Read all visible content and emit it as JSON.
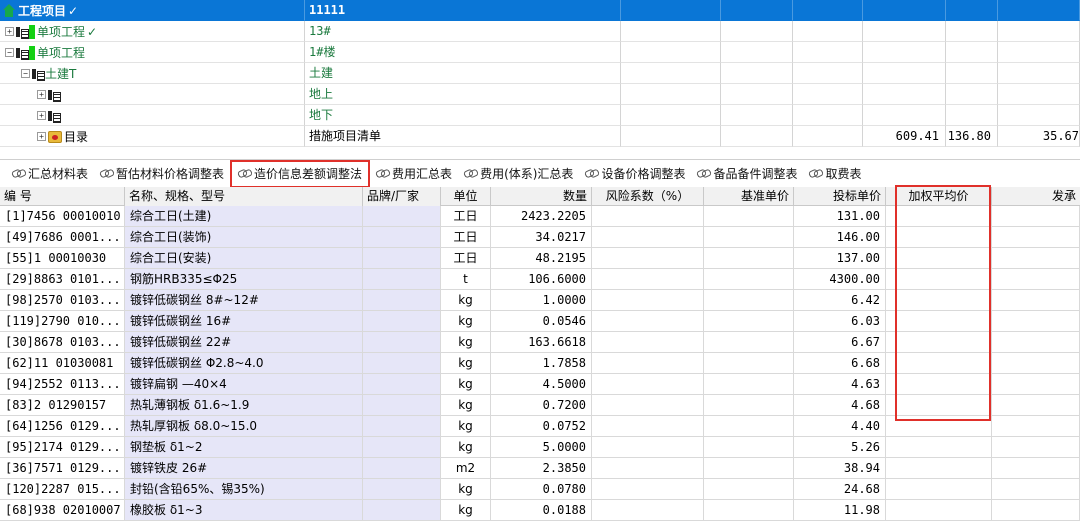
{
  "tree": {
    "rows": [
      {
        "name": "工程项目",
        "code": "11111",
        "selected": true,
        "icon": "home-icon"
      },
      {
        "name": "单项工程",
        "code": "13#",
        "icon": "grid-icon"
      },
      {
        "name": "单项工程",
        "code": "1#楼",
        "icon": "grid-icon"
      },
      {
        "name": "土建T",
        "code": "土建",
        "icon": "grid-icon"
      },
      {
        "name": "",
        "code": "地上",
        "icon": "grid-icon"
      },
      {
        "name": "",
        "code": "地下",
        "icon": "grid-icon"
      },
      {
        "name": "目录",
        "code": "措施项目清单",
        "icon": "folder-icon",
        "v1": "609.41",
        "v2": "136.80",
        "v3": "35.67"
      }
    ]
  },
  "tabs": [
    {
      "label": "汇总材料表"
    },
    {
      "label": "暂估材料价格调整表"
    },
    {
      "label": "造价信息差额调整法",
      "active": true
    },
    {
      "label": "费用汇总表"
    },
    {
      "label": "费用(体系)汇总表"
    },
    {
      "label": "设备价格调整表"
    },
    {
      "label": "备品备件调整表"
    },
    {
      "label": "取费表"
    }
  ],
  "grid": {
    "headers": [
      "编 号",
      "名称、规格、型号",
      "品牌/厂家",
      "单位",
      "数量",
      "风险系数（%）",
      "基准单价",
      "投标单价",
      "加权平均价",
      "发承"
    ],
    "rows": [
      {
        "code": "[1]7456 00010010",
        "name": "综合工日(土建)",
        "unit": "工日",
        "qty": "2423.2205",
        "price": "131.00"
      },
      {
        "code": "[49]7686 0001...",
        "name": "综合工日(装饰)",
        "unit": "工日",
        "qty": "34.0217",
        "price": "146.00"
      },
      {
        "code": "[55]1 00010030",
        "name": "综合工日(安装)",
        "unit": "工日",
        "qty": "48.2195",
        "price": "137.00"
      },
      {
        "code": "[29]8863 0101...",
        "name": "钢筋HRB335≤Φ25",
        "unit": "t",
        "qty": "106.6000",
        "price": "4300.00"
      },
      {
        "code": "[98]2570 0103...",
        "name": "镀锌低碳钢丝 8#~12#",
        "unit": "kg",
        "qty": "1.0000",
        "price": "6.42"
      },
      {
        "code": "[119]2790 010...",
        "name": "镀锌低碳钢丝 16#",
        "unit": "kg",
        "qty": "0.0546",
        "price": "6.03"
      },
      {
        "code": "[30]8678 0103...",
        "name": "镀锌低碳钢丝 22#",
        "unit": "kg",
        "qty": "163.6618",
        "price": "6.67"
      },
      {
        "code": "[62]11 01030081",
        "name": "镀锌低碳钢丝 Φ2.8~4.0",
        "unit": "kg",
        "qty": "1.7858",
        "price": "6.68"
      },
      {
        "code": "[94]2552 0113...",
        "name": "镀锌扁钢 —40×4",
        "unit": "kg",
        "qty": "4.5000",
        "price": "4.63"
      },
      {
        "code": "[83]2 01290157",
        "name": "热轧薄钢板 δ1.6~1.9",
        "unit": "kg",
        "qty": "0.7200",
        "price": "4.68"
      },
      {
        "code": "[64]1256 0129...",
        "name": "热轧厚钢板 δ8.0~15.0",
        "unit": "kg",
        "qty": "0.0752",
        "price": "4.40"
      },
      {
        "code": "[95]2174 0129...",
        "name": "钢垫板 δ1~2",
        "unit": "kg",
        "qty": "5.0000",
        "price": "5.26"
      },
      {
        "code": "[36]7571 0129...",
        "name": "镀锌铁皮 26#",
        "unit": "m2",
        "qty": "2.3850",
        "price": "38.94"
      },
      {
        "code": "[120]2287 015...",
        "name": "封铅(含铅65%、锡35%)",
        "unit": "kg",
        "qty": "0.0780",
        "price": "24.68"
      },
      {
        "code": "[68]938 02010007",
        "name": "橡胶板 δ1~3",
        "unit": "kg",
        "qty": "0.0188",
        "price": "11.98"
      }
    ]
  }
}
